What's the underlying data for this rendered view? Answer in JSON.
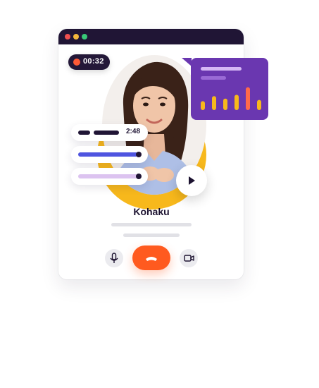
{
  "call": {
    "timer": "00:32",
    "contact_name": "Kohaku"
  },
  "audio": {
    "duration": "2:48"
  },
  "colors": {
    "window_titlebar": "#201535",
    "record_dot": "#ff5a36",
    "accent_yellow": "#f7b81c",
    "end_call": "#ff5a1f",
    "stats_card": "#6a37b0",
    "stats_bar": "#f7b81c",
    "stats_bar_highlight": "#ff6a4a",
    "progress_blue": "#4f55e0",
    "progress_lavender": "#dcc3f0"
  },
  "stats": {
    "bar_levels": [
      0.35,
      0.55,
      0.45,
      0.6,
      0.9,
      0.4
    ],
    "highlight_index": 4
  },
  "icons": {
    "mic": "microphone-icon",
    "end_call": "phone-hangup-icon",
    "camera": "video-camera-icon",
    "play": "play-icon"
  }
}
